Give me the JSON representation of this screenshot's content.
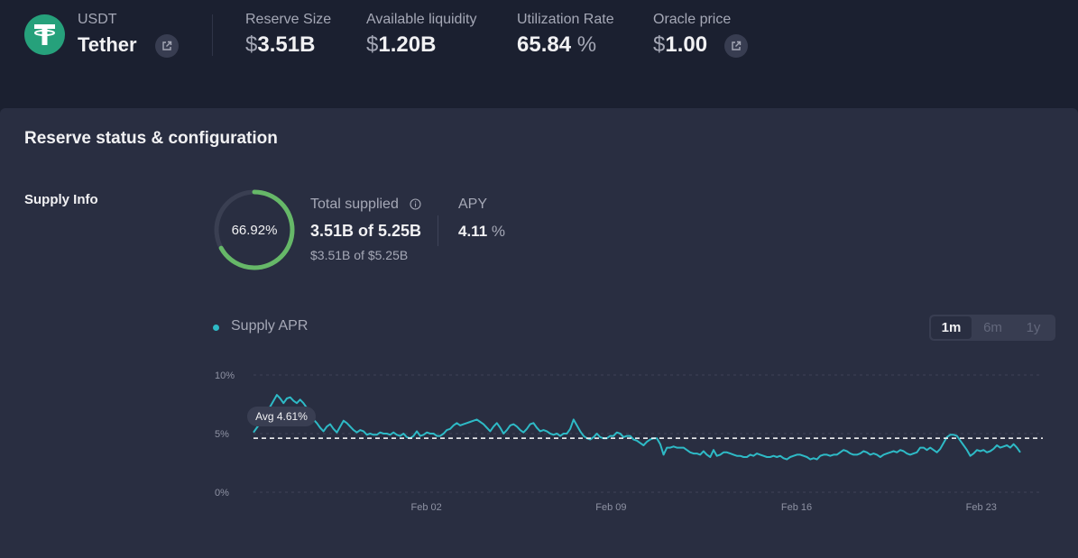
{
  "asset": {
    "symbol": "USDT",
    "name": "Tether",
    "logo_icon": "tether-logo-icon",
    "brand_color": "#26a17b"
  },
  "stats": {
    "reserve_size": {
      "label": "Reserve Size",
      "currency": "$",
      "value": "3.51B"
    },
    "available_liquidity": {
      "label": "Available liquidity",
      "currency": "$",
      "value": "1.20B"
    },
    "utilization_rate": {
      "label": "Utilization Rate",
      "value": "65.84",
      "unit": "%"
    },
    "oracle_price": {
      "label": "Oracle price",
      "currency": "$",
      "value": "1.00"
    }
  },
  "panel": {
    "title": "Reserve status & configuration",
    "supply_info": {
      "section_label": "Supply Info",
      "ring_percent_text": "66.92%",
      "ring_fraction": 0.6692,
      "ring_color": "#66b868",
      "total_supplied_label": "Total supplied",
      "total_supplied_value": "3.51B of 5.25B",
      "total_supplied_usd": "$3.51B of $5.25B",
      "apy_label": "APY",
      "apy_value": "4.11",
      "apy_unit": "%"
    }
  },
  "chart_controls": {
    "legend_label": "Supply APR",
    "legend_color": "#2ebac6",
    "ranges": [
      "1m",
      "6m",
      "1y"
    ],
    "selected_range": "1m"
  },
  "chart_data": {
    "type": "line",
    "y_ticks": [
      "10%",
      "5%",
      "0%"
    ],
    "x_ticks": [
      "Feb 02",
      "Feb 09",
      "Feb 16",
      "Feb 23"
    ],
    "ylim": [
      0,
      10
    ],
    "average": {
      "label": "Avg 4.61%",
      "value": 4.61
    },
    "series": [
      {
        "color": "#2ebac6",
        "values": [
          5.1,
          5.5,
          5.9,
          6.4,
          6.9,
          7.3,
          7.8,
          8.3,
          8.0,
          7.6,
          8.0,
          8.1,
          7.8,
          7.6,
          7.9,
          7.6,
          7.2,
          6.8,
          6.2,
          5.9,
          5.5,
          5.2,
          5.6,
          5.8,
          5.4,
          5.1,
          5.6,
          6.1,
          5.9,
          5.6,
          5.3,
          5.1,
          5.3,
          5.2,
          4.9,
          5.0,
          4.9,
          4.9,
          5.1,
          5.0,
          5.0,
          4.9,
          5.1,
          4.9,
          4.8,
          5.0,
          4.7,
          4.6,
          4.8,
          5.2,
          4.8,
          4.9,
          5.1,
          5.0,
          5.0,
          4.8,
          4.8,
          5.0,
          5.3,
          5.4,
          5.7,
          5.9,
          5.7,
          5.8,
          5.9,
          6.0,
          6.1,
          6.2,
          6.0,
          5.8,
          5.5,
          5.2,
          5.6,
          5.9,
          5.5,
          5.0,
          5.3,
          5.7,
          5.8,
          5.6,
          5.3,
          5.1,
          5.4,
          5.8,
          5.9,
          5.5,
          5.2,
          5.3,
          5.2,
          5.0,
          4.9,
          5.0,
          4.8,
          5.0,
          5.0,
          5.4,
          6.2,
          5.7,
          5.2,
          4.8,
          4.6,
          4.5,
          4.7,
          5.0,
          4.7,
          4.6,
          4.6,
          4.8,
          4.8,
          5.1,
          5.0,
          4.7,
          4.8,
          4.8,
          4.5,
          4.4,
          4.2,
          4.0,
          4.3,
          4.5,
          4.6,
          4.6,
          4.1,
          3.2,
          3.8,
          3.8,
          3.9,
          3.8,
          3.8,
          3.8,
          3.6,
          3.4,
          3.3,
          3.3,
          3.2,
          3.5,
          3.2,
          3.0,
          3.6,
          3.1,
          3.2,
          3.4,
          3.4,
          3.3,
          3.2,
          3.1,
          3.1,
          3.0,
          3.0,
          3.2,
          3.1,
          3.3,
          3.2,
          3.1,
          3.0,
          3.0,
          3.1,
          3.0,
          3.1,
          2.9,
          2.8,
          3.0,
          3.1,
          3.2,
          3.2,
          3.1,
          3.0,
          2.8,
          2.9,
          2.8,
          3.1,
          3.2,
          3.2,
          3.1,
          3.2,
          3.2,
          3.4,
          3.6,
          3.5,
          3.3,
          3.2,
          3.2,
          3.3,
          3.5,
          3.4,
          3.2,
          3.3,
          3.2,
          3.0,
          3.2,
          3.3,
          3.4,
          3.5,
          3.4,
          3.6,
          3.5,
          3.3,
          3.2,
          3.3,
          3.4,
          3.8,
          3.8,
          3.6,
          3.8,
          3.6,
          3.4,
          3.7,
          4.2,
          4.7,
          4.9,
          4.9,
          4.8,
          4.4,
          4.0,
          3.6,
          3.1,
          3.3,
          3.6,
          3.5,
          3.6,
          3.4,
          3.5,
          3.7,
          4.0,
          3.8,
          3.9,
          4.0,
          3.8,
          4.1,
          3.8,
          3.4
        ]
      }
    ]
  }
}
